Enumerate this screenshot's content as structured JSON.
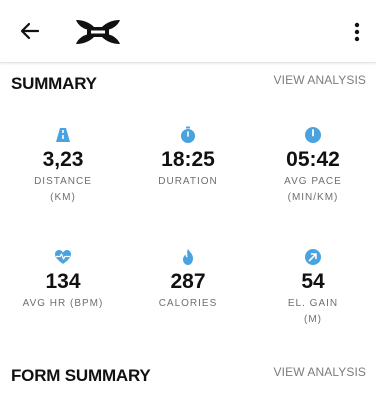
{
  "colors": {
    "accent": "#4aa3df",
    "text": "#111111",
    "muted": "#6f6f6f"
  },
  "topbar": {
    "back_icon": "arrow-left-icon",
    "logo_icon": "under-armour-logo",
    "more_icon": "more-vertical-icon"
  },
  "summary": {
    "title": "SUMMARY",
    "link": "VIEW ANALYSIS",
    "stats": [
      {
        "icon": "road-icon",
        "value": "3,23",
        "label1": "DISTANCE",
        "label2": "(KM)"
      },
      {
        "icon": "stopwatch-icon",
        "value": "18:25",
        "label1": "DURATION",
        "label2": ""
      },
      {
        "icon": "speedometer-icon",
        "value": "05:42",
        "label1": "AVG PACE",
        "label2": "(MIN/KM)"
      },
      {
        "icon": "heart-rate-icon",
        "value": "134",
        "label1": "AVG HR (BPM)",
        "label2": ""
      },
      {
        "icon": "flame-icon",
        "value": "287",
        "label1": "CALORIES",
        "label2": ""
      },
      {
        "icon": "elevation-arrow-icon",
        "value": "54",
        "label1": "EL. GAIN",
        "label2": "(M)"
      }
    ]
  },
  "form_summary": {
    "title": "FORM SUMMARY",
    "link": "VIEW ANALYSIS"
  }
}
